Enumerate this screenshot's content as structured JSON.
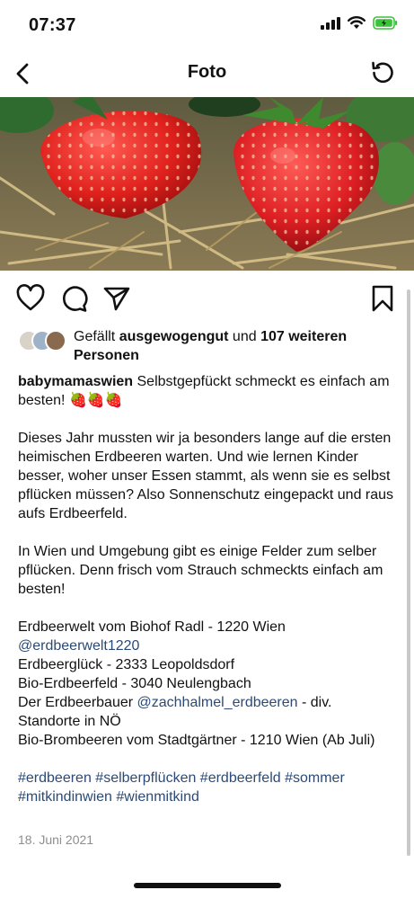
{
  "status": {
    "time": "07:37"
  },
  "nav": {
    "title": "Foto"
  },
  "likes": {
    "prefix": "Gefällt ",
    "user": "ausgewogengut",
    "middle": " und ",
    "count": "107 weiteren Personen"
  },
  "post": {
    "author": "babymamaswien",
    "intro": " Selbstgepfückt schmeckt es einfach am besten! ",
    "emoji": "🍓🍓🍓",
    "para1": "Dieses Jahr mussten wir ja besonders lange auf die ersten heimischen Erdbeeren warten. Und wie lernen Kinder besser, woher unser Essen stammt, als wenn sie es selbst pflücken müssen? Also Sonnenschutz eingepackt und raus aufs Erdbeerfeld.",
    "para2": "In Wien und Umgebung gibt es einige Felder zum selber pflücken. Denn frisch vom Strauch schmeckts einfach am besten!",
    "line1": "Erdbeerwelt vom Biohof Radl - 1220 Wien",
    "line1_link": "@erdbeerwelt1220",
    "line2": "Erdbeerglück -  2333 Leopoldsdorf",
    "line3": "Bio-Erdbeerfeld - 3040 Neulengbach",
    "line4_pre": "Der Erdbeerbauer ",
    "line4_link": "@zachhalmel_erdbeeren",
    "line4_post": " - div. Standorte in NÖ",
    "line5": "Bio-Brombeeren vom Stadtgärtner - 1210 Wien (Ab Juli)",
    "hashtags": "#erdbeeren #selberpflücken #erdbeerfeld #sommer #mitkindinwien #wienmitkind",
    "date": "18. Juni 2021"
  },
  "colors": {
    "link": "#2b4a77",
    "battery": "#3cc13b"
  },
  "icons": [
    "back-icon",
    "refresh-icon",
    "heart-icon",
    "comment-icon",
    "share-icon",
    "bookmark-icon"
  ]
}
